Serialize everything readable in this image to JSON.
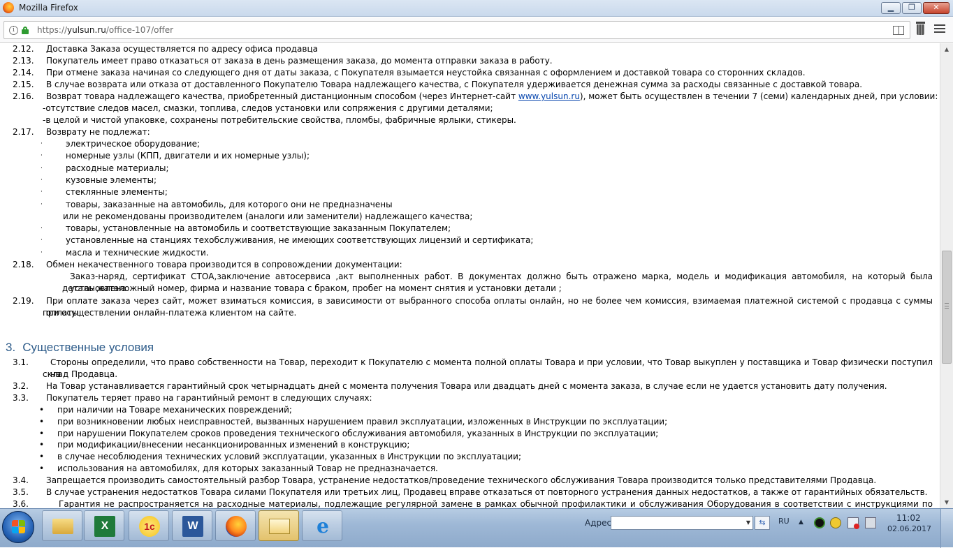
{
  "window": {
    "title": "Mozilla Firefox",
    "minimize_label": "▁",
    "maximize_label": "❐",
    "close_label": "✕"
  },
  "navbar": {
    "url_prefix": "https://",
    "url_host": "yulsun.ru",
    "url_path": "/office-107/offer"
  },
  "section2": {
    "i12": {
      "num": "2.12.",
      "text": "Доставка Заказа осуществляется по адресу офиса продавца"
    },
    "i13": {
      "num": "2.13.",
      "text": "Покупатель имеет право отказаться от заказа в день размещения заказа, до момента отправки заказа в работу."
    },
    "i14": {
      "num": "2.14.",
      "text": "При отмене заказа начиная со следующего дня от даты заказа, с Покупателя взымается неустойка связанная с оформлением и доставкой товара со сторонних складов."
    },
    "i15": {
      "num": "2.15.",
      "text": "В случае возврата или отказа от доставленного Покупателю Товара надлежащего качества, с Покупателя удерживается денежная сумма за расходы связанные с доставкой товара."
    },
    "i16": {
      "num": "2.16.",
      "text_before": "Возврат товара надлежащего качества, приобретенный дистанционным способом (через Интернет-сайт ",
      "link": "www.yulsun.ru",
      "text_after": "), может быть осуществлен в течении 7 (семи) календарных дней, при условии:",
      "sub1": "-отсутствие следов масел, смазки, топлива, следов установки или сопряжения с другими деталями;",
      "sub2": "-в целой и чистой упаковке, сохранены потребительские свойства, пломбы, фабричные ярлыки, стикеры."
    },
    "i17": {
      "num": "2.17.",
      "text": "Возврату не подлежат:",
      "dot": "·",
      "list": [
        "электрическое оборудование;",
        "номерные узлы (КПП, двигатели и их номерные узлы);",
        "расходные материалы;",
        "кузовные элементы;",
        "стеклянные элементы;",
        "товары, заказанные на автомобиль, для которого они не предназначены",
        "или не рекомендованы производителем (аналоги или заменители) надлежащего качества;",
        "товары, установленные на автомобиль и соответствующие заказанным Покупателем;",
        "установленные на станциях техобслуживания, не имеющих соответствующих лицензий и сертификата;",
        "масла и технические жидкости."
      ]
    },
    "i18": {
      "num": "2.18.",
      "text": "Обмен некачественного товара производится в сопровождении документации:",
      "line1": "Заказ-наряд, сертификат СТОА,заключение автосервиса ,акт выполненных работ. В документах должно быть отражено марка, модель и модификация автомобиля, на который была установлена",
      "line2": "деталь ,каталожный номер, фирма и название товара с браком, пробег на момент снятия и установки детали ;"
    },
    "i19": {
      "num": "2.19.",
      "line1": "При оплате заказа через сайт, может взиматься комиссия, в зависимости от выбранного способа оплаты онлайн, но не более чем комиссия, взимаемая платежной системой с продавца с суммы оплаты,",
      "line2": "при осуществлении онлайн-платежа клиентом на сайте."
    }
  },
  "section3": {
    "heading_num": "3.",
    "heading_text": "Существенные условия",
    "i1": {
      "num": "3.1.",
      "line1": "Стороны определили, что право собственности на Товар, переходит к Покупателю с момента полной оплаты Товара и при условии, что Товар выкуплен у поставщика и Товар физически поступил на",
      "line2": "склад Продавца."
    },
    "i2": {
      "num": "3.2.",
      "text": "На Товар устанавливается гарантийный срок четырнадцать дней с момента получения Товара или двадцать дней с момента заказа, в случае если не удается установить дату получения."
    },
    "i3": {
      "num": "3.3.",
      "text": "Покупатель теряет право на гарантийный ремонт в следующих случаях:",
      "bullet": "•",
      "list": [
        "при наличии на Товаре механических повреждений;",
        "при возникновении любых неисправностей, вызванных нарушением правил эксплуатации, изложенных в Инструкции по эксплуатации;",
        "при нарушении Покупателем сроков проведения технического обслуживания автомобиля, указанных в Инструкции по эксплуатации;",
        "при модификации/внесении несанкционированных изменений в конструкцию;",
        "в случае несоблюдения технических условий эксплуатации, указанных в Инструкции по эксплуатации;",
        "использования на автомобилях, для которых заказанный Товар не предназначается."
      ]
    },
    "i4": {
      "num": "3.4.",
      "text": "Запрещается производить самостоятельный разбор Товара, устранение недостатков/проведение технического обслуживания Товара производится только представителями Продавца."
    },
    "i5": {
      "num": "3.5.",
      "text": "В случае устранения недостатков Товара силами Покупателя или третьих лиц, Продавец вправе отказаться от повторного устранения данных недостатков, а также от гарантийных обязательств."
    },
    "i6": {
      "num": "3.6.",
      "text": "Гарантия не распространяется на расходные материалы, подлежащие регулярной замене в рамках обычной профилактики и обслуживания Оборудования в соответствии с инструкциями по"
    }
  },
  "scrollbar": {
    "up_arrow": "▲",
    "down_arrow": "▼"
  },
  "taskbar": {
    "address_label": "Адрес",
    "address_value": "",
    "go_label": "⇆",
    "language": "RU",
    "tray_up": "▲",
    "clock_time": "11:02",
    "clock_date": "02.06.2017"
  }
}
